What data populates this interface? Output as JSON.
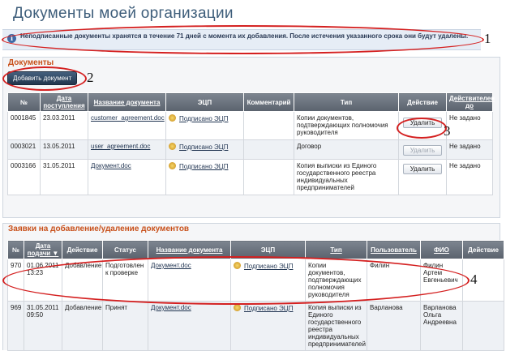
{
  "page_title": "Документы моей организации",
  "info_text": "Неподписанные документы хранятся в течение 71 дней с момента их добавления. После истечения указанного срока они будут удалены.",
  "annotations": [
    "1",
    "2",
    "3",
    "4"
  ],
  "documents": {
    "title": "Документы",
    "add_button": "Добавить документ",
    "headers": [
      "№",
      "Дата поступления",
      "Название документа",
      "ЭЦП",
      "Комментарий",
      "Тип",
      "Действие",
      "Действителен до"
    ],
    "rows": [
      {
        "num": "0001845",
        "date": "23.03.2011",
        "name": "customer_agreement.doc",
        "sign": "Подписано ЭЦП",
        "comment": "",
        "type": "Копии документов, подтверждающих полномочия руководителя",
        "action": "Удалить",
        "valid": "Не задано"
      },
      {
        "num": "0003021",
        "date": "13.05.2011",
        "name": "user_agreement.doc",
        "sign": "Подписано ЭЦП",
        "comment": "",
        "type": "Договор",
        "action": "Удалить",
        "valid": "Не задано"
      },
      {
        "num": "0003166",
        "date": "31.05.2011",
        "name": "Документ.doc",
        "sign": "Подписано ЭЦП",
        "comment": "",
        "type": "Копия выписки из Единого государственного реестра индивидуальных предпринимателей",
        "action": "Удалить",
        "valid": "Не задано"
      }
    ]
  },
  "requests": {
    "title": "Заявки на добавление/удаление документов",
    "headers": [
      "№",
      "Дата подачи ▼",
      "Действие",
      "Статус",
      "Название документа",
      "ЭЦП",
      "Тип",
      "Пользователь",
      "ФИО",
      "Действие"
    ],
    "rows": [
      {
        "num": "970",
        "date": "01.06.2011 13:23",
        "action": "Добавление",
        "status": "Подготовлен к проверке",
        "name": "Документ.doc",
        "sign": "Подписано ЭЦП",
        "type": "Копии документов, подтверждающих полномочия руководителя",
        "user": "Филин",
        "fio": "Филин Артем Евгеньевич",
        "act": ""
      },
      {
        "num": "969",
        "date": "31.05.2011 09:50",
        "action": "Добавление",
        "status": "Принят",
        "name": "Документ.doc",
        "sign": "Подписано ЭЦП",
        "type": "Копия выписки из Единого государственного реестра индивидуальных предпринимателей",
        "user": "Варланова",
        "fio": "Варланова Ольга Андреевна",
        "act": ""
      }
    ]
  }
}
